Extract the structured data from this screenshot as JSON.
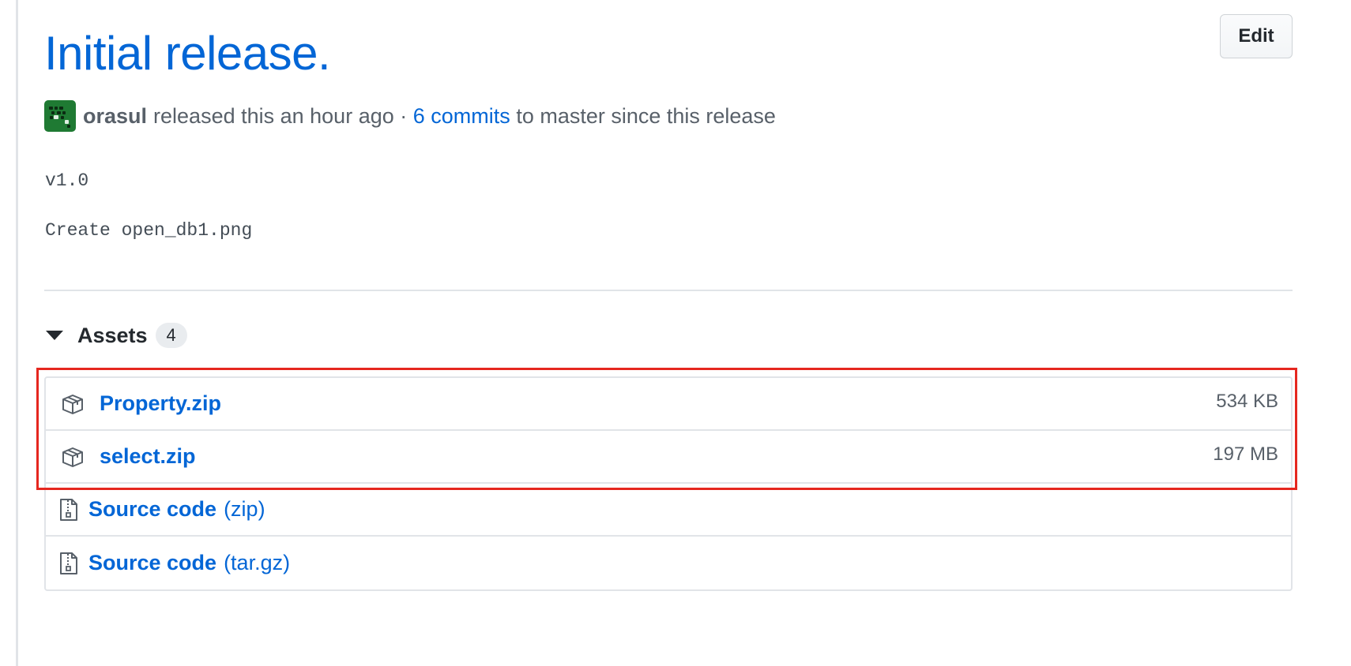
{
  "release": {
    "title": "Initial release.",
    "edit_label": "Edit",
    "author": "orasul",
    "released_text": "released this an hour ago ·",
    "commits_link": "6 commits",
    "commits_suffix": "to master since this release",
    "tag_line": "v1.0",
    "commit_message": "Create open_db1.png"
  },
  "assets": {
    "heading": "Assets",
    "count": "4",
    "items": [
      {
        "name": "Property.zip",
        "suffix": "",
        "size": "534 KB",
        "icon": "package-icon"
      },
      {
        "name": "select.zip",
        "suffix": "",
        "size": "197 MB",
        "icon": "package-icon"
      },
      {
        "name": "Source code",
        "suffix": "(zip)",
        "size": "",
        "icon": "file-zip-icon"
      },
      {
        "name": "Source code",
        "suffix": "(tar.gz)",
        "size": "",
        "icon": "file-zip-icon"
      }
    ]
  },
  "colors": {
    "link": "#0366d6",
    "muted": "#586069",
    "highlight": "#e5271f",
    "avatar": "#1f7a33"
  }
}
